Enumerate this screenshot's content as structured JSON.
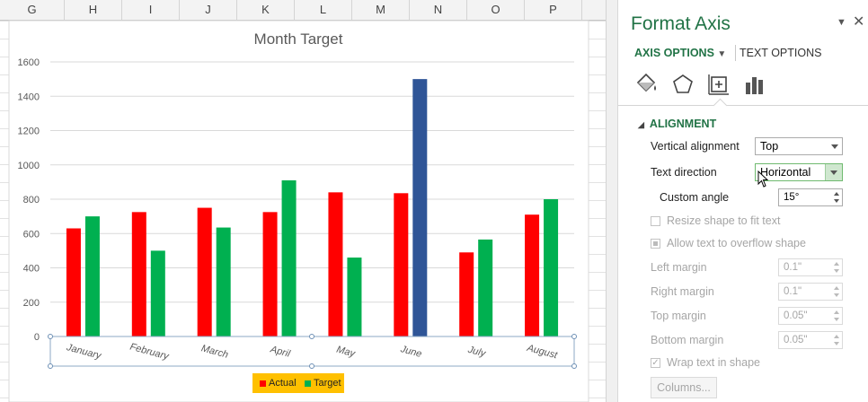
{
  "spreadsheet": {
    "columns": [
      "G",
      "H",
      "I",
      "J",
      "K",
      "L",
      "M",
      "N",
      "O",
      "P"
    ]
  },
  "chart_data": {
    "type": "bar",
    "title": "Month Target",
    "categories": [
      "January",
      "February",
      "March",
      "April",
      "May",
      "June",
      "July",
      "August"
    ],
    "series": [
      {
        "name": "Actual",
        "values": [
          630,
          725,
          750,
          725,
          840,
          835,
          490,
          710
        ],
        "color": "#ff0000"
      },
      {
        "name": "Target",
        "values": [
          700,
          500,
          635,
          910,
          460,
          1500,
          565,
          800
        ],
        "color": "#00b050"
      }
    ],
    "highlight": {
      "category": "June",
      "series": "Target",
      "color": "#2f5597"
    },
    "ylim": [
      0,
      1600
    ],
    "yticks": [
      0,
      200,
      400,
      600,
      800,
      1000,
      1200,
      1400,
      1600
    ],
    "grid": true,
    "legend_position": "bottom",
    "xlabel": "",
    "ylabel": ""
  },
  "pane": {
    "title": "Format Axis",
    "tab_axis": "AXIS OPTIONS",
    "tab_text": "TEXT OPTIONS",
    "section": "ALIGNMENT",
    "vertical_alignment": {
      "label": "Vertical alignment",
      "value": "Top"
    },
    "text_direction": {
      "label": "Text direction",
      "value": "Horizontal"
    },
    "custom_angle": {
      "label": "Custom angle",
      "value": "15°"
    },
    "resize_label": "Resize shape to fit text",
    "overflow_label": "Allow text to overflow shape",
    "left_margin": {
      "label": "Left margin",
      "value": "0.1\""
    },
    "right_margin": {
      "label": "Right margin",
      "value": "0.1\""
    },
    "top_margin": {
      "label": "Top margin",
      "value": "0.05\""
    },
    "bottom_margin": {
      "label": "Bottom margin",
      "value": "0.05\""
    },
    "wrap_label": "Wrap text in shape",
    "columns_button": "Columns..."
  }
}
